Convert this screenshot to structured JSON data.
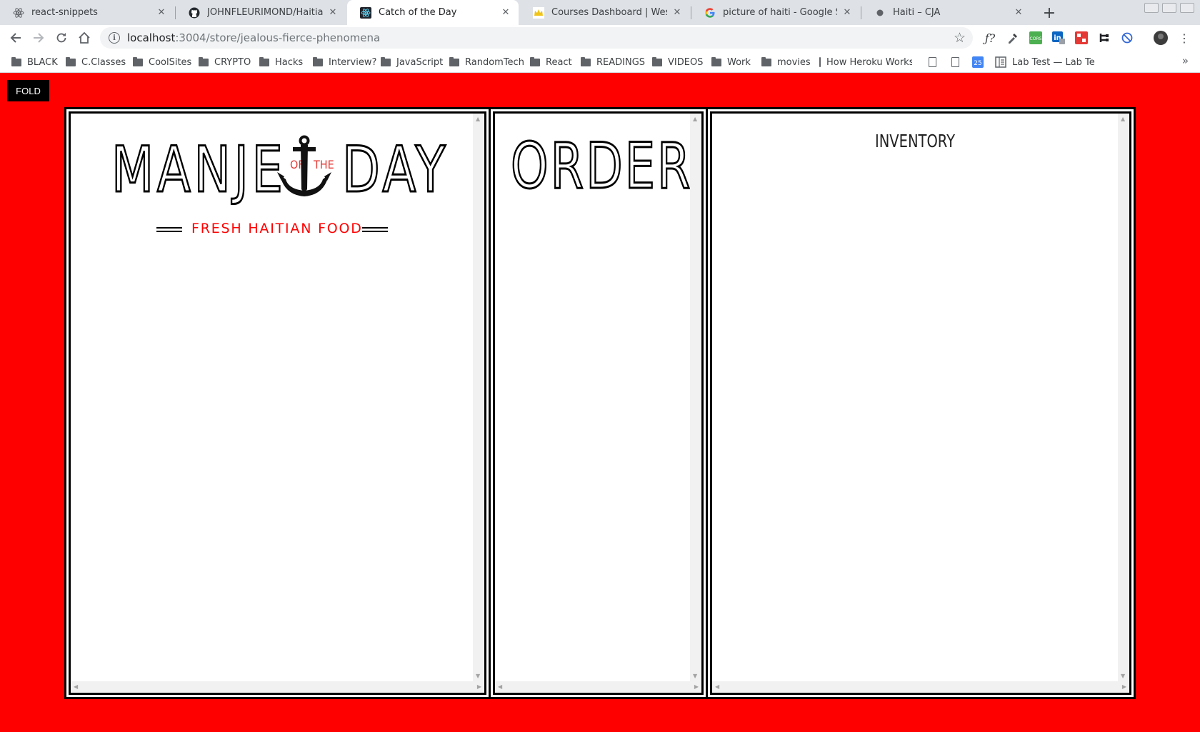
{
  "browser": {
    "tabs": [
      {
        "title": "react-snippets",
        "icon": "atom-icon"
      },
      {
        "title": "JOHNFLEURIMOND/HaitianFood",
        "icon": "github-icon"
      },
      {
        "title": "Catch of the Day",
        "icon": "react-icon",
        "active": true
      },
      {
        "title": "Courses Dashboard | Wes Bos",
        "icon": "crown-icon"
      },
      {
        "title": "picture of haiti - Google Search",
        "icon": "google-icon"
      },
      {
        "title": "Haiti – CJA",
        "icon": "globe-icon"
      }
    ],
    "tab_close_glyph": "✕",
    "new_tab_glyph": "+",
    "url": {
      "host": "localhost",
      "path": ":3004/store/jealous-fierce-phenomena"
    },
    "bookmarks": [
      {
        "label": "BLACK",
        "type": "folder"
      },
      {
        "label": "C.Classes",
        "type": "folder"
      },
      {
        "label": "CoolSites",
        "type": "folder"
      },
      {
        "label": "CRYPTO",
        "type": "folder"
      },
      {
        "label": "Hacks",
        "type": "folder"
      },
      {
        "label": "Interview?",
        "type": "folder"
      },
      {
        "label": "JavaScript",
        "type": "folder"
      },
      {
        "label": "RandomTech",
        "type": "folder"
      },
      {
        "label": "React",
        "type": "folder"
      },
      {
        "label": "READINGS",
        "type": "folder"
      },
      {
        "label": "VIDEOS",
        "type": "folder"
      },
      {
        "label": "Work",
        "type": "folder"
      },
      {
        "label": "movies",
        "type": "folder"
      },
      {
        "label": "How Heroku Works",
        "type": "page"
      },
      {
        "label": "",
        "type": "page"
      },
      {
        "label": "",
        "type": "page"
      },
      {
        "label": "",
        "type": "calendar"
      },
      {
        "label": "Lab Test — Lab Test",
        "type": "doc"
      }
    ],
    "bookmarks_overflow": "»"
  },
  "page": {
    "fold_label": "FOLD",
    "menu": {
      "logo_word_left": "MANJE",
      "logo_of": "OF",
      "logo_the": "THE",
      "logo_word_right": "DAY",
      "tagline": "FRESH HAITIAN FOOD"
    },
    "order": {
      "heading": "ORDER!"
    },
    "inventory": {
      "heading": "INVENTORY"
    }
  },
  "colors": {
    "background": "#ff0000",
    "accent": "#e53935"
  }
}
